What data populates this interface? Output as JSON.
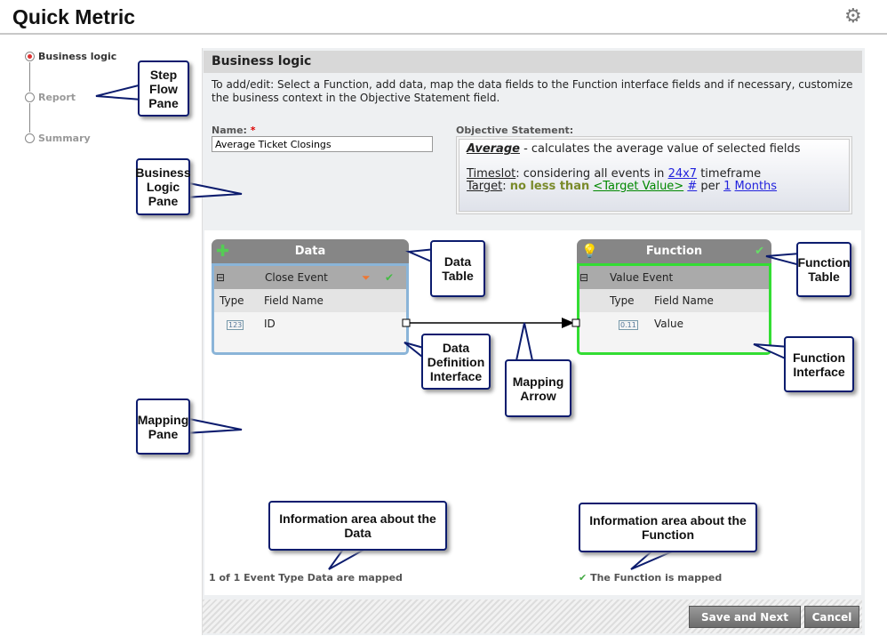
{
  "header": {
    "title": "Quick Metric",
    "settings_icon": "gear-icon"
  },
  "steps": [
    {
      "label": "Business logic",
      "active": true
    },
    {
      "label": "Report",
      "active": false
    },
    {
      "label": "Summary",
      "active": false
    }
  ],
  "business_logic": {
    "title": "Business logic",
    "instructions": "To add/edit: Select a Function, add data, map the data fields to the Function interface fields and if necessary, customize the business context in the Objective Statement field.",
    "name_label": "Name:",
    "name_required": "*",
    "name_value": "Average Ticket Closings",
    "objective_label": "Objective Statement:",
    "objective": {
      "function": "Average",
      "function_desc": " - calculates the average value of selected fields",
      "timeslot_label": "Timeslot",
      "timeslot_text": ": considering all events in ",
      "timeslot_value": "24x7",
      "timeslot_suffix": " timeframe",
      "target_label": "Target",
      "target_sep": ": ",
      "target_cond": "no less than",
      "target_value": "<Target Value>",
      "target_unit": "#",
      "per": " per ",
      "period_count": "1",
      "period_unit": "Months"
    }
  },
  "data_table": {
    "title": "Data",
    "event": "Close Event",
    "col_type": "Type",
    "col_field": "Field Name",
    "rows": [
      {
        "type": "123",
        "field": "ID"
      }
    ]
  },
  "function_table": {
    "title": "Function",
    "event": "Value Event",
    "col_type": "Type",
    "col_field": "Field Name",
    "rows": [
      {
        "type": "0.11",
        "field": "Value"
      }
    ]
  },
  "info": {
    "data": "1 of 1 Event Type Data are mapped",
    "function": "The Function is mapped"
  },
  "buttons": {
    "save_next": "Save and Next",
    "cancel": "Cancel"
  },
  "callouts": {
    "step_flow": "Step Flow Pane",
    "business_logic": "Business Logic Pane",
    "data_table": "Data Table",
    "function_table": "Function Table",
    "data_def": "Data Definition Interface",
    "mapping_arrow": "Mapping Arrow",
    "function_interface": "Function Interface",
    "mapping_pane": "Mapping Pane",
    "info_data": "Information area about the Data",
    "info_function": "Information area about the Function"
  }
}
